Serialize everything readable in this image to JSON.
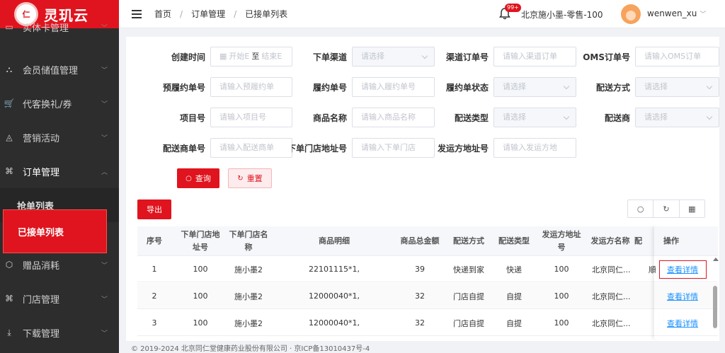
{
  "brand": {
    "logo_text": "灵玑云",
    "seal_text": "仁"
  },
  "sidebar": {
    "items": [
      {
        "label": "实体卡管理",
        "icon": "card-icon",
        "arrow": "chevron-down"
      },
      {
        "label": "会员储值管理",
        "icon": "member-icon",
        "arrow": "chevron-down"
      },
      {
        "label": "代客换礼/券",
        "icon": "cart-icon",
        "arrow": "chevron-down"
      },
      {
        "label": "营销活动",
        "icon": "marketing-icon",
        "arrow": "chevron-down"
      },
      {
        "label": "订单管理",
        "icon": "grid-icon",
        "arrow": "chevron-up"
      },
      {
        "label": "赠品消耗",
        "icon": "gift-icon",
        "arrow": "chevron-down"
      },
      {
        "label": "门店管理",
        "icon": "grid-icon",
        "arrow": "chevron-down"
      },
      {
        "label": "下载管理",
        "icon": "download-icon",
        "arrow": "chevron-down"
      }
    ],
    "subitems": [
      {
        "label": "抢单列表",
        "active": false
      },
      {
        "label": "已接单列表",
        "active": true
      }
    ]
  },
  "header": {
    "breadcrumb": [
      "首页",
      "订单管理",
      "已接单列表"
    ],
    "badge": "99+",
    "store": "北京施小墨-零售-100",
    "user": "wenwen_xu"
  },
  "form": {
    "row1": [
      {
        "label": "创建时间",
        "type": "daterange",
        "start": "开始E",
        "to": "至",
        "end": "结束E"
      },
      {
        "label": "下单渠道",
        "type": "select",
        "placeholder": "请选择"
      },
      {
        "label": "渠道订单号",
        "type": "input",
        "placeholder": "请输入渠道订单"
      },
      {
        "label": "OMS订单号",
        "type": "input",
        "placeholder": "请输入OMS订单"
      }
    ],
    "row2": [
      {
        "label": "预履约单号",
        "type": "input",
        "placeholder": "请输入预履约单"
      },
      {
        "label": "履约单号",
        "type": "input",
        "placeholder": "请输入履约单号"
      },
      {
        "label": "履约单状态",
        "type": "select",
        "placeholder": "请选择"
      },
      {
        "label": "配送方式",
        "type": "select",
        "placeholder": "请选择"
      }
    ],
    "row3": [
      {
        "label": "项目号",
        "type": "input",
        "placeholder": "请输入项目号"
      },
      {
        "label": "商品名称",
        "type": "input",
        "placeholder": "请输入商品名称"
      },
      {
        "label": "配送类型",
        "type": "select",
        "placeholder": "请选择"
      },
      {
        "label": "配送商",
        "type": "select",
        "placeholder": "请选择"
      }
    ],
    "row4": [
      {
        "label": "配送商单号",
        "type": "input",
        "placeholder": "请输入配送商单"
      },
      {
        "label": "下单门店地址号",
        "type": "input",
        "placeholder": "请输入下单门店"
      },
      {
        "label": "发运方地址号",
        "type": "input",
        "placeholder": "请输入发运方地"
      }
    ],
    "query_label": "查询",
    "reset_label": "重置",
    "export_label": "导出"
  },
  "table": {
    "headers": [
      "序号",
      "下单门店地址号",
      "下单门店名称",
      "商品明细",
      "商品总金额",
      "配送方式",
      "配送类型",
      "发运方地址号",
      "发运方名称",
      "配",
      "操作"
    ],
    "rows": [
      {
        "idx": "1",
        "store_addr": "100",
        "store_name": "施小墨2",
        "goods": "22101115*1,",
        "amount": "39",
        "method": "快递到家",
        "type": "快递",
        "ship_addr": "100",
        "ship_name": "北京同仁...",
        "extra": "順",
        "op": "查看详情"
      },
      {
        "idx": "2",
        "store_addr": "100",
        "store_name": "施小墨2",
        "goods": "12000040*1,",
        "amount": "32",
        "method": "门店自提",
        "type": "自提",
        "ship_addr": "100",
        "ship_name": "北京同仁...",
        "extra": "",
        "op": "查看详情"
      },
      {
        "idx": "3",
        "store_addr": "100",
        "store_name": "施小墨2",
        "goods": "12000040*1,",
        "amount": "32",
        "method": "门店自提",
        "type": "自提",
        "ship_addr": "100",
        "ship_name": "北京同仁...",
        "extra": "",
        "op": "查看详情"
      }
    ]
  },
  "footer": "© 2019-2024 北京同仁堂健康药业股份有限公司 · 京ICP备13010437号-4",
  "colors": {
    "brand_red": "#e0141e",
    "sidebar_bg": "#2d2d2d",
    "link_blue": "#1890ff"
  }
}
